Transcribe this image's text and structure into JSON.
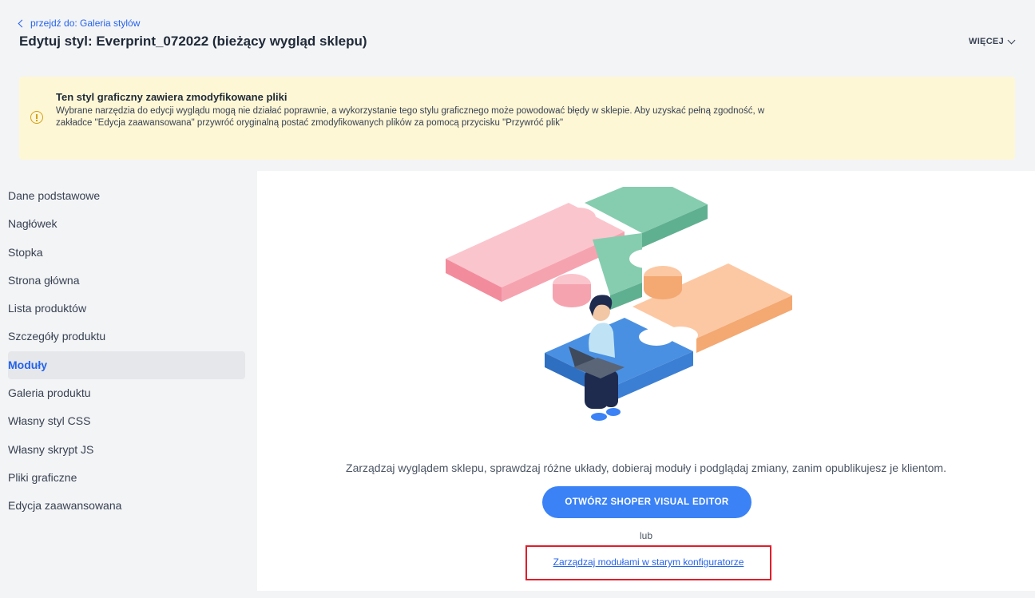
{
  "header": {
    "back_link": "przejdź do: Galeria stylów",
    "title": "Edytuj styl: Everprint_072022 (bieżący wygląd sklepu)",
    "more_label": "WIĘCEJ"
  },
  "alert": {
    "icon": "info-circle-icon",
    "title": "Ten styl graficzny zawiera zmodyfikowane pliki",
    "text": "Wybrane narzędzia do edycji wyglądu mogą nie działać poprawnie, a wykorzystanie tego stylu graficznego może powodować błędy w sklepie. Aby uzyskać pełną zgodność, w zakładce \"Edycja zaawansowana\" przywróć oryginalną postać zmodyfikowanych plików za pomocą przycisku \"Przywróć plik\"",
    "background_color": "#fef7d6"
  },
  "sidebar": {
    "items": [
      {
        "label": "Dane podstawowe",
        "active": false
      },
      {
        "label": "Nagłówek",
        "active": false
      },
      {
        "label": "Stopka",
        "active": false
      },
      {
        "label": "Strona główna",
        "active": false
      },
      {
        "label": "Lista produktów",
        "active": false
      },
      {
        "label": "Szczegóły produktu",
        "active": false
      },
      {
        "label": "Moduły",
        "active": true
      },
      {
        "label": "Galeria produktu",
        "active": false
      },
      {
        "label": "Własny styl CSS",
        "active": false
      },
      {
        "label": "Własny skrypt JS",
        "active": false
      },
      {
        "label": "Pliki graficzne",
        "active": false
      },
      {
        "label": "Edycja zaawansowana",
        "active": false
      }
    ]
  },
  "main": {
    "illustration": "puzzle-pieces-person-laptop-illustration",
    "description": "Zarządzaj wyglądem sklepu, sprawdzaj różne układy, dobieraj moduły i podglądaj zmiany, zanim opublikujesz je klientom.",
    "editor_button": "OTWÓRZ SHOPER VISUAL EDITOR",
    "or_text": "lub",
    "legacy_link": "Zarządzaj modułami w starym konfiguratorze"
  },
  "colors": {
    "accent": "#3b82f6",
    "link": "#2563eb",
    "highlight_border": "#e11d2a",
    "puzzle_pink": "#f9a8b3",
    "puzzle_green": "#7fc8a9",
    "puzzle_orange": "#fbc49b",
    "puzzle_blue": "#4a90e2"
  }
}
